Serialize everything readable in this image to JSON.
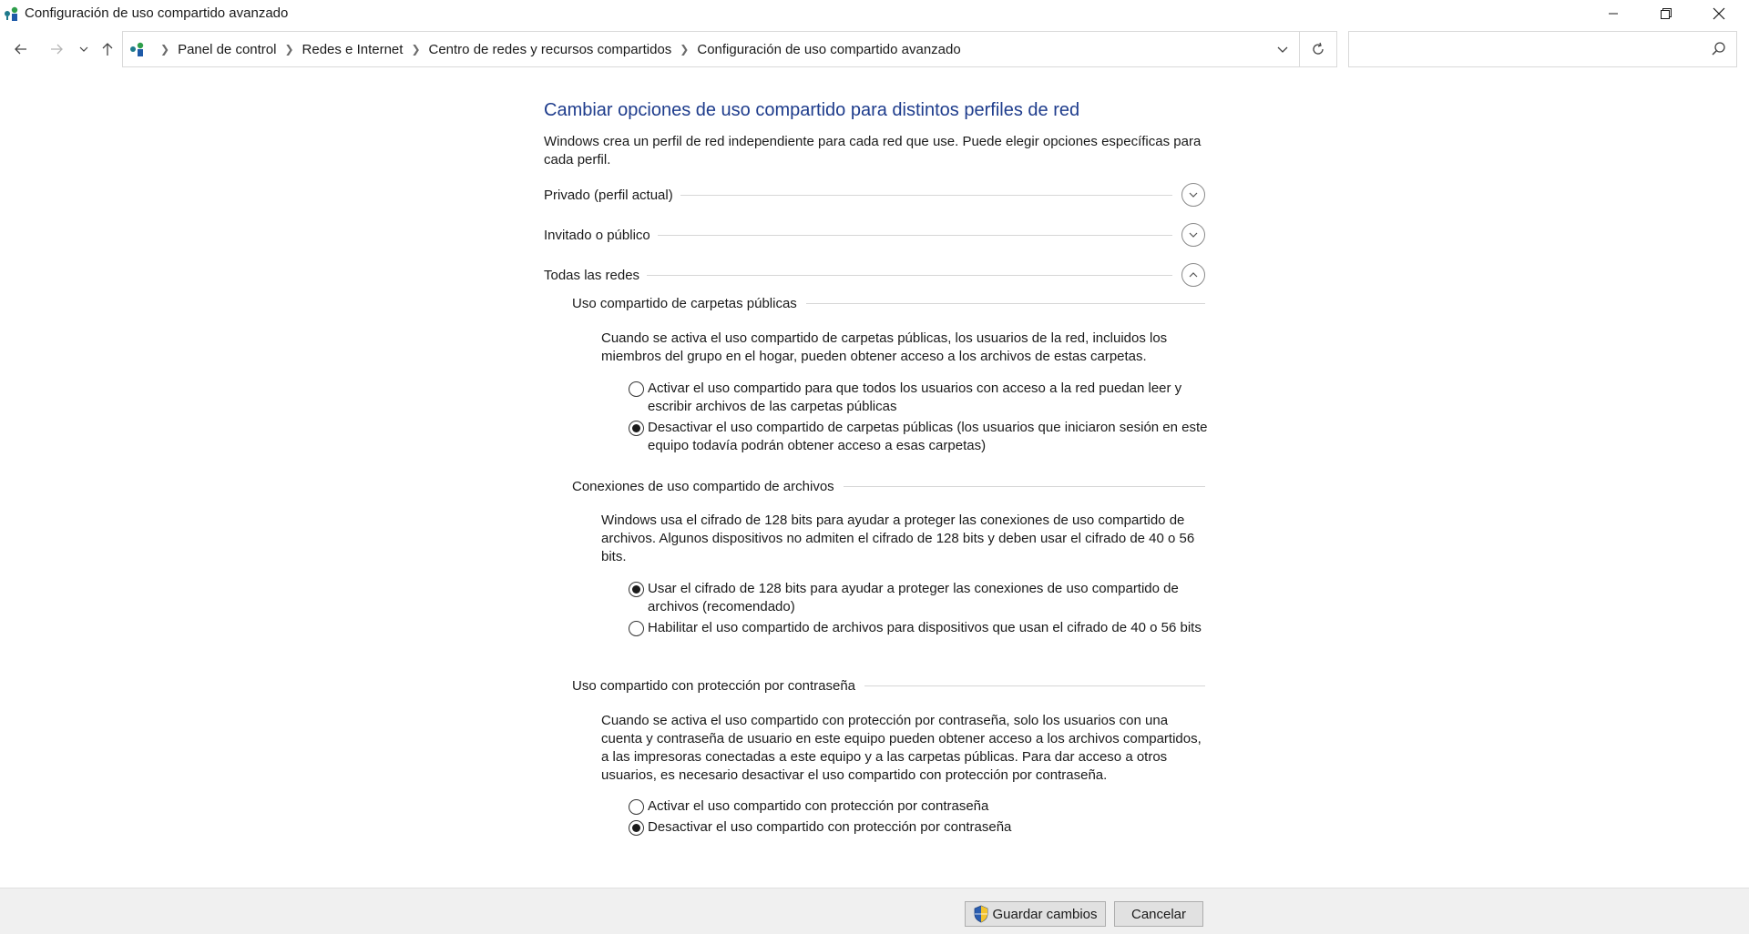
{
  "window": {
    "title": "Configuración de uso compartido avanzado"
  },
  "address": {
    "crumbs": [
      "Panel de control",
      "Redes e Internet",
      "Centro de redes y recursos compartidos",
      "Configuración de uso compartido avanzado"
    ]
  },
  "search": {
    "value": "",
    "placeholder": ""
  },
  "main": {
    "heading": "Cambiar opciones de uso compartido para distintos perfiles de red",
    "intro": "Windows crea un perfil de red independiente para cada red que use. Puede elegir opciones específicas para cada perfil.",
    "profiles": [
      {
        "label": "Privado (perfil actual)",
        "expanded": false
      },
      {
        "label": "Invitado o público",
        "expanded": false
      },
      {
        "label": "Todas las redes",
        "expanded": true
      }
    ],
    "sections": [
      {
        "title": "Uso compartido de carpetas públicas",
        "description": "Cuando se activa el uso compartido de carpetas públicas, los usuarios de la red, incluidos los miembros del grupo en el hogar, pueden obtener acceso a los archivos de estas carpetas.",
        "options": [
          {
            "label": "Activar el uso compartido para que todos los usuarios con acceso a la red puedan leer y escribir archivos de las carpetas públicas",
            "selected": false
          },
          {
            "label": "Desactivar el uso compartido de carpetas públicas (los usuarios que iniciaron sesión en este equipo todavía podrán obtener acceso a esas carpetas)",
            "selected": true
          }
        ]
      },
      {
        "title": "Conexiones de uso compartido de archivos",
        "description": "Windows usa el cifrado de 128 bits para ayudar a proteger las conexiones de uso compartido de archivos. Algunos dispositivos no admiten el cifrado de 128 bits y deben usar el cifrado de 40 o 56 bits.",
        "options": [
          {
            "label": "Usar el cifrado de 128 bits para ayudar a proteger las conexiones de uso compartido de archivos (recomendado)",
            "selected": true
          },
          {
            "label": "Habilitar el uso compartido de archivos para dispositivos que usan el cifrado de 40 o 56 bits",
            "selected": false
          }
        ]
      },
      {
        "title": "Uso compartido con protección por contraseña",
        "description": "Cuando se activa el uso compartido con protección por contraseña, solo los usuarios con una cuenta y contraseña de usuario en este equipo pueden obtener acceso a los archivos compartidos, a las impresoras conectadas a este equipo y a las carpetas públicas. Para dar acceso a otros usuarios, es necesario desactivar el uso compartido con protección por contraseña.",
        "options": [
          {
            "label": "Activar el uso compartido con protección por contraseña",
            "selected": false
          },
          {
            "label": "Desactivar el uso compartido con protección por contraseña",
            "selected": true
          }
        ]
      }
    ]
  },
  "footer": {
    "save_label": "Guardar cambios",
    "cancel_label": "Cancelar"
  },
  "icons": {
    "app": "network-sharing-icon",
    "minimize": "minimize-icon",
    "maximize": "restore-icon",
    "close": "close-icon",
    "back": "back-arrow-icon",
    "forward": "forward-arrow-icon",
    "recent": "chevron-down-icon",
    "up": "up-arrow-icon",
    "refresh": "refresh-icon",
    "search": "search-icon",
    "shield": "uac-shield-icon"
  },
  "colors": {
    "heading": "#1e3c8c",
    "footer_bg": "#f0f0f0",
    "button_bg": "#e1e1e1"
  }
}
